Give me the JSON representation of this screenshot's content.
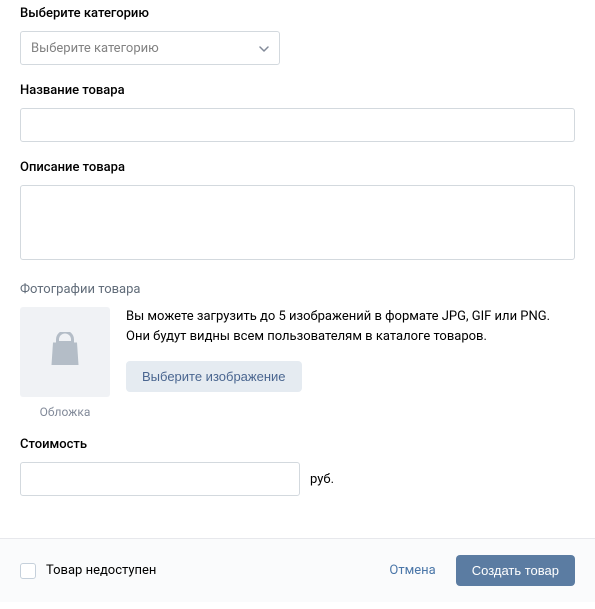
{
  "category": {
    "label": "Выберите категорию",
    "placeholder": "Выберите категорию"
  },
  "name": {
    "label": "Название товара",
    "value": ""
  },
  "description": {
    "label": "Описание товара",
    "value": ""
  },
  "photos": {
    "label": "Фотографии товара",
    "thumb_caption": "Обложка",
    "hint": "Вы можете загрузить до 5 изображений в формате JPG, GIF или PNG. Они будут видны всем пользователям в каталоге товаров.",
    "choose_button": "Выберите изображение"
  },
  "price": {
    "label": "Стоимость",
    "value": "",
    "currency": "руб."
  },
  "footer": {
    "unavailable_label": "Товар недоступен",
    "cancel": "Отмена",
    "submit": "Создать товар"
  }
}
